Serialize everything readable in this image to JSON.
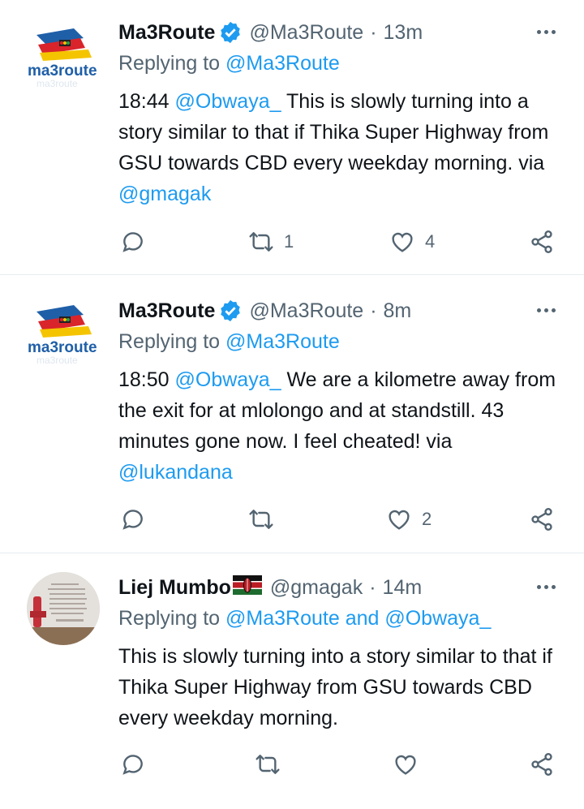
{
  "tweets": [
    {
      "avatar_icon": "ma3route-logo",
      "name": "Ma3Route",
      "verified": true,
      "handle": "@Ma3Route",
      "time": "13m",
      "reply_prefix": "Replying to",
      "reply_to": "@Ma3Route",
      "body": [
        {
          "t": "18:44 ",
          "link": false
        },
        {
          "t": "@Obwaya_",
          "link": true
        },
        {
          "t": " This is slowly turning into a story similar to that if Thika Super Highway from GSU towards CBD every weekday morning. via ",
          "link": false
        },
        {
          "t": "@gmagak",
          "link": true
        }
      ],
      "replies": "",
      "retweets": "1",
      "likes": "4"
    },
    {
      "avatar_icon": "ma3route-logo",
      "name": "Ma3Route",
      "verified": true,
      "handle": "@Ma3Route",
      "time": "8m",
      "reply_prefix": "Replying to",
      "reply_to": "@Ma3Route",
      "body": [
        {
          "t": "18:50 ",
          "link": false
        },
        {
          "t": "@Obwaya_",
          "link": true
        },
        {
          "t": " We are a kilometre away from the exit for at mlolongo  and at standstill. 43 minutes gone now. I feel cheated! via ",
          "link": false
        },
        {
          "t": "@lukandana",
          "link": true
        }
      ],
      "replies": "",
      "retweets": "",
      "likes": "2"
    },
    {
      "avatar_icon": "user-photo",
      "name": "Liej Mumbo",
      "flag_icon": "kenya-flag-icon",
      "verified": false,
      "handle": "@gmagak",
      "time": "14m",
      "reply_prefix": "Replying to",
      "reply_to": "@Ma3Route and @Obwaya_",
      "body": [
        {
          "t": "This is slowly turning into a story similar to that if Thika Super Highway from GSU towards CBD every weekday morning.",
          "link": false
        }
      ],
      "replies": "",
      "retweets": "",
      "likes": ""
    }
  ],
  "logo_text": "ma3route",
  "colors": {
    "accent": "#1d9bf0",
    "secondary_text": "#536471",
    "divider": "#e6ecf0"
  }
}
